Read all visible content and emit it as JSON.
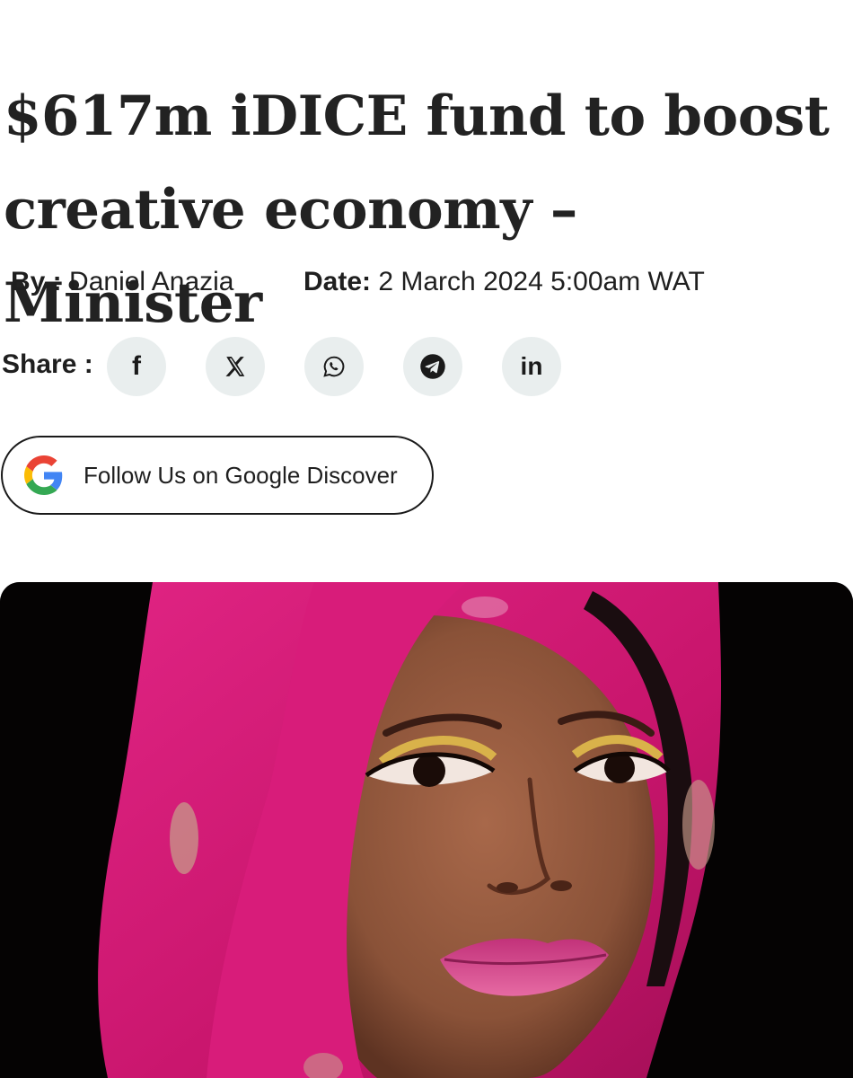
{
  "article": {
    "headline": "$617m iDICE fund to boost creative economy – Minister",
    "byline_label": "By :",
    "author": "Daniel Anazia",
    "date_label": "Date:",
    "date_value": "2 March 2024 5:00am WAT"
  },
  "share": {
    "label": "Share :",
    "buttons": [
      {
        "icon": "facebook-icon",
        "glyph": "f"
      },
      {
        "icon": "x-icon",
        "glyph": "𝕏"
      },
      {
        "icon": "whatsapp-icon"
      },
      {
        "icon": "telegram-icon"
      },
      {
        "icon": "linkedin-icon",
        "glyph": "in"
      }
    ]
  },
  "google_discover": {
    "label": "Follow Us on Google Discover",
    "icon": "google-g-icon"
  },
  "hero_image": {
    "icon": "portrait-photo",
    "colors": {
      "background": "#050303",
      "headscarf": "#d01a74",
      "skin": "#8a5238"
    }
  }
}
